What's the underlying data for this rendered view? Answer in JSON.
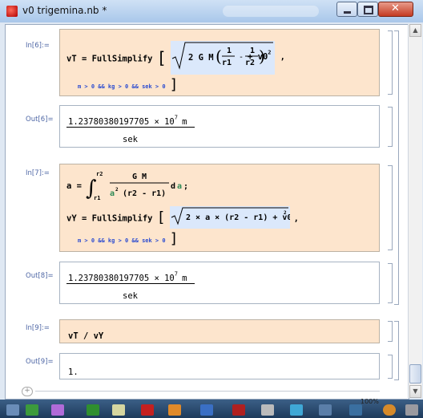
{
  "window": {
    "title": "v0 trigemina.nb *"
  },
  "cells": {
    "in6_label": "In[6]:=",
    "in6_line1": "vT = FullSimplify",
    "in6_cond": "m > 0 && kg > 0 && sek > 0",
    "out6_label": "Out[6]=",
    "out6_value": "1.23780380197705 × 10",
    "out6_exp": "7",
    "out6_unit_num": "m",
    "out6_unit_den": "sek",
    "in7_label": "In[7]:=",
    "in7_line1_a": "a =",
    "in7_line2": "vY = FullSimplify",
    "in7_cond": "m > 0 && kg > 0 && sek > 0",
    "out8_label": "Out[8]=",
    "out8_value": "1.23780380197705 × 10",
    "out8_exp": "7",
    "out8_unit_num": "m",
    "out8_unit_den": "sek",
    "in9_label": "In[9]:=",
    "in9_text": "vT / vY",
    "out9_label": "Out[9]=",
    "out9_text": "1."
  },
  "status": {
    "zoom": "100%"
  }
}
